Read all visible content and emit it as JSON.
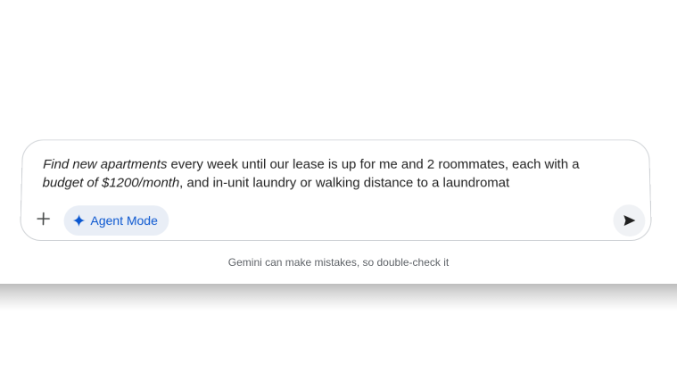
{
  "composer": {
    "prompt_part1": "Find new apartments",
    "prompt_part2": " every week until our lease is up for me and 2 roommates, each with a ",
    "prompt_part3": "budget of $1200/month",
    "prompt_part4": ", and in-unit laundry or walking distance to a laundromat",
    "add_icon": "plus-icon",
    "agent_mode_label": "Agent Mode",
    "agent_mode_icon": "sparkle-icon",
    "send_icon": "send-icon",
    "accent_color": "#0b57d0"
  },
  "footer": {
    "disclaimer": "Gemini can make mistakes, so double-check it"
  }
}
